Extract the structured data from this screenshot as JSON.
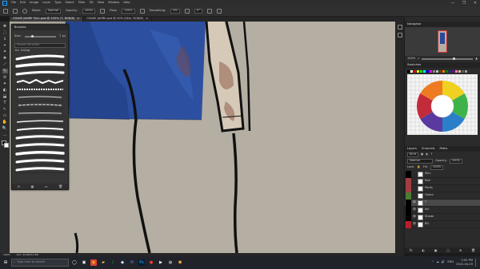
{
  "menu": {
    "app_logo": "Ps",
    "items": [
      "File",
      "Edit",
      "Image",
      "Layer",
      "Type",
      "Select",
      "Filter",
      "3D",
      "View",
      "Window",
      "Help"
    ],
    "window_controls": [
      "—",
      "❐",
      "✕"
    ]
  },
  "options": {
    "mode_label": "Mode:",
    "mode_value": "Normal",
    "opacity_label": "Opacity:",
    "opacity_value": "100%",
    "flow_label": "Flow:",
    "flow_value": "100%",
    "smoothing_label": "Smoothing:",
    "smoothing_value": "0%",
    "angle_value": "0°"
  },
  "tabs": [
    {
      "label": "CHASE JAHRE TALL.psd @ 100% (T, RGB/8)",
      "active": true
    },
    {
      "label": "CHASE JAHRE.psd @ 50% (Skin, RGB/8)",
      "active": false
    }
  ],
  "tabs_close": "×",
  "tools": [
    "✥",
    "⬚",
    "ʖ",
    "⌖",
    "⌗",
    "✚",
    "⟋",
    "✎",
    "⊘",
    "✦",
    "◐",
    "⬓",
    "T",
    "↖",
    "▭",
    "✋",
    "🔍",
    "…"
  ],
  "brushes": {
    "title": "Brushes",
    "size_label": "Size:",
    "size_value": "7 px",
    "search_placeholder": "Search Brushes",
    "folder_label": "Inking",
    "footer_icons": [
      "⊙",
      "▦",
      "▭",
      "🗑"
    ]
  },
  "navigator": {
    "title": "Navigator",
    "zoom_value": "100%"
  },
  "swatches": {
    "title": "Swatches",
    "colors": [
      "#000000",
      "#ffffff",
      "#ff0000",
      "#ffff00",
      "#00ff00",
      "#00ffff",
      "#0000ff",
      "#ff00ff",
      "#888888",
      "#c0c0c0",
      "#804000",
      "#ff8000",
      "#008000",
      "#004080",
      "#800080",
      "#ff80c0",
      "#e0c090",
      "#606060",
      "#a0a0a0",
      "#303030"
    ]
  },
  "layers": {
    "tabs": [
      "Layers",
      "Channels",
      "Paths"
    ],
    "kind_label": "Kind",
    "blend_value": "Normal",
    "opacity_label": "Opacity:",
    "opacity_value": "100%",
    "lock_label": "Lock:",
    "fill_label": "Fill:",
    "fill_value": "100%",
    "items": [
      {
        "name": "Skin",
        "color": "#000000",
        "visible": false,
        "selected": false
      },
      {
        "name": "Red",
        "color": "#a33d40",
        "visible": false,
        "selected": false
      },
      {
        "name": "Pants",
        "color": "#a33d40",
        "visible": false,
        "selected": false
      },
      {
        "name": "Green",
        "color": "#4d7a34",
        "visible": false,
        "selected": false
      },
      {
        "name": "T",
        "color": "#000000",
        "visible": true,
        "selected": true
      },
      {
        "name": "Ink",
        "color": "#000000",
        "visible": true,
        "selected": false
      },
      {
        "name": "Shade",
        "color": "#000000",
        "visible": true,
        "selected": false
      },
      {
        "name": "BG",
        "color": "#b5202d",
        "visible": true,
        "selected": false
      }
    ],
    "footer_icons": [
      "fx",
      "◐",
      "▣",
      "▢",
      "⊕",
      "🗑"
    ]
  },
  "status": {
    "zoom": "100%",
    "doc_info": "Doc: 22.6M/71.9M"
  },
  "taskbar": {
    "search_placeholder": "Type here to search",
    "apps": [
      {
        "glyph": "◯",
        "color": "#ffffff",
        "bg": "#20232a"
      },
      {
        "glyph": "▣",
        "color": "#ffffff",
        "bg": "#20232a"
      },
      {
        "glyph": "◉",
        "color": "#fbbc05",
        "bg": "#db4437"
      },
      {
        "glyph": "▰",
        "color": "#f2c744",
        "bg": "#20232a"
      },
      {
        "glyph": "♪",
        "color": "#1db954",
        "bg": "#20232a"
      },
      {
        "glyph": "◆",
        "color": "#ffffff",
        "bg": "#1b2838"
      },
      {
        "glyph": "✉",
        "color": "#7289da",
        "bg": "#20232a"
      },
      {
        "glyph": "Ps",
        "color": "#31a8ff",
        "bg": "#001e36"
      },
      {
        "glyph": "●",
        "color": "#ff3b30",
        "bg": "#20232a"
      },
      {
        "glyph": "▶",
        "color": "#ffffff",
        "bg": "#20232a"
      },
      {
        "glyph": "◍",
        "color": "#ffffff",
        "bg": "#20232a"
      },
      {
        "glyph": "⬢",
        "color": "#e9a23b",
        "bg": "#20232a"
      }
    ],
    "tray_icons": [
      "^",
      "☁",
      "🔊",
      "ENG"
    ],
    "time": "2:05 PM",
    "date": "2022-04-29"
  }
}
